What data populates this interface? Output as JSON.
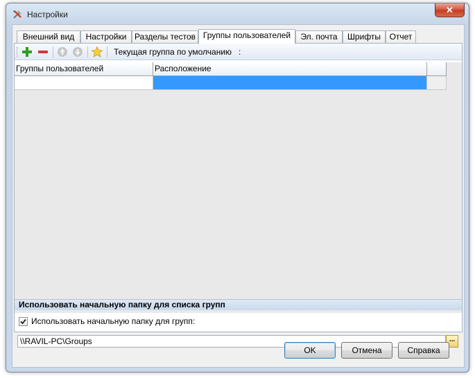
{
  "window": {
    "title": "Настройки",
    "close_glyph": "✕",
    "icon": "tools-icon"
  },
  "tabs": [
    {
      "label": "Внешний вид"
    },
    {
      "label": "Настройки"
    },
    {
      "label": "Разделы тестов"
    },
    {
      "label": "Группы пользователей"
    },
    {
      "label": "Эл. почта"
    },
    {
      "label": "Шрифты"
    },
    {
      "label": "Отчет"
    }
  ],
  "active_tab": "Группы пользователей",
  "toolbar": {
    "default_group_label": "Текущая группа по умолчанию   :",
    "icons": [
      "add-icon",
      "remove-icon",
      "move-up-icon",
      "move-down-icon",
      "star-icon"
    ]
  },
  "grid": {
    "columns": [
      "Группы пользователей",
      "Расположение"
    ],
    "rows": [
      {
        "group": "",
        "location": ""
      }
    ]
  },
  "root_folder": {
    "section_title": "Использовать начальную папку для списка групп",
    "checkbox_label": "Использовать начальную папку для групп:",
    "checked": true,
    "path": "\\\\RAVIL-PC\\Groups",
    "browse_label": "..."
  },
  "buttons": {
    "ok": "OK",
    "cancel": "Отмена",
    "help": "Справка"
  },
  "colors": {
    "selection": "#3399ff",
    "accent": "#3c7fb1"
  }
}
